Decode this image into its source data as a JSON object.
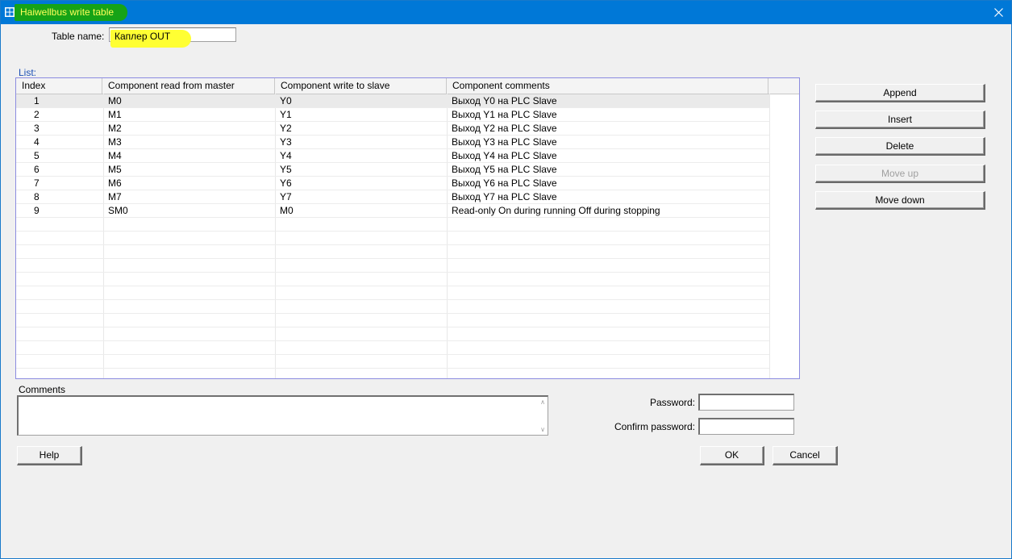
{
  "window": {
    "title": "Haiwellbus write table",
    "title_bar_color": "#0078d7",
    "highlight_green": "#16a316",
    "highlight_yellow": "#ffff33"
  },
  "form": {
    "table_name_label": "Table name:",
    "table_name_value": "Каплер OUT",
    "list_label": "List:"
  },
  "table": {
    "columns": [
      "Index",
      "Component read from master",
      "Component write to slave",
      "Component comments"
    ],
    "rows": [
      {
        "index": "1",
        "read": "M0",
        "write": "Y0",
        "comment": "Выход Y0 на PLC Slave"
      },
      {
        "index": "2",
        "read": "M1",
        "write": "Y1",
        "comment": "Выход Y1 на PLC Slave"
      },
      {
        "index": "3",
        "read": "M2",
        "write": "Y2",
        "comment": "Выход Y2 на PLC Slave"
      },
      {
        "index": "4",
        "read": "M3",
        "write": "Y3",
        "comment": "Выход Y3 на PLC Slave"
      },
      {
        "index": "5",
        "read": "M4",
        "write": "Y4",
        "comment": "Выход Y4 на PLC Slave"
      },
      {
        "index": "6",
        "read": "M5",
        "write": "Y5",
        "comment": "Выход Y5 на PLC Slave"
      },
      {
        "index": "7",
        "read": "M6",
        "write": "Y6",
        "comment": "Выход Y6 на PLC Slave"
      },
      {
        "index": "8",
        "read": "M7",
        "write": "Y7",
        "comment": "Выход Y7 на PLC Slave"
      },
      {
        "index": "9",
        "read": "SM0",
        "write": "M0",
        "comment": "Read-only On during running  Off during stopping"
      }
    ]
  },
  "side_buttons": {
    "append": "Append",
    "insert": "Insert",
    "delete": "Delete",
    "move_up": "Move up",
    "move_down": "Move down"
  },
  "comments": {
    "label": "Comments",
    "value": ""
  },
  "password": {
    "password_label": "Password:",
    "confirm_label": "Confirm password:"
  },
  "footer": {
    "help": "Help",
    "ok": "OK",
    "cancel": "Cancel"
  }
}
